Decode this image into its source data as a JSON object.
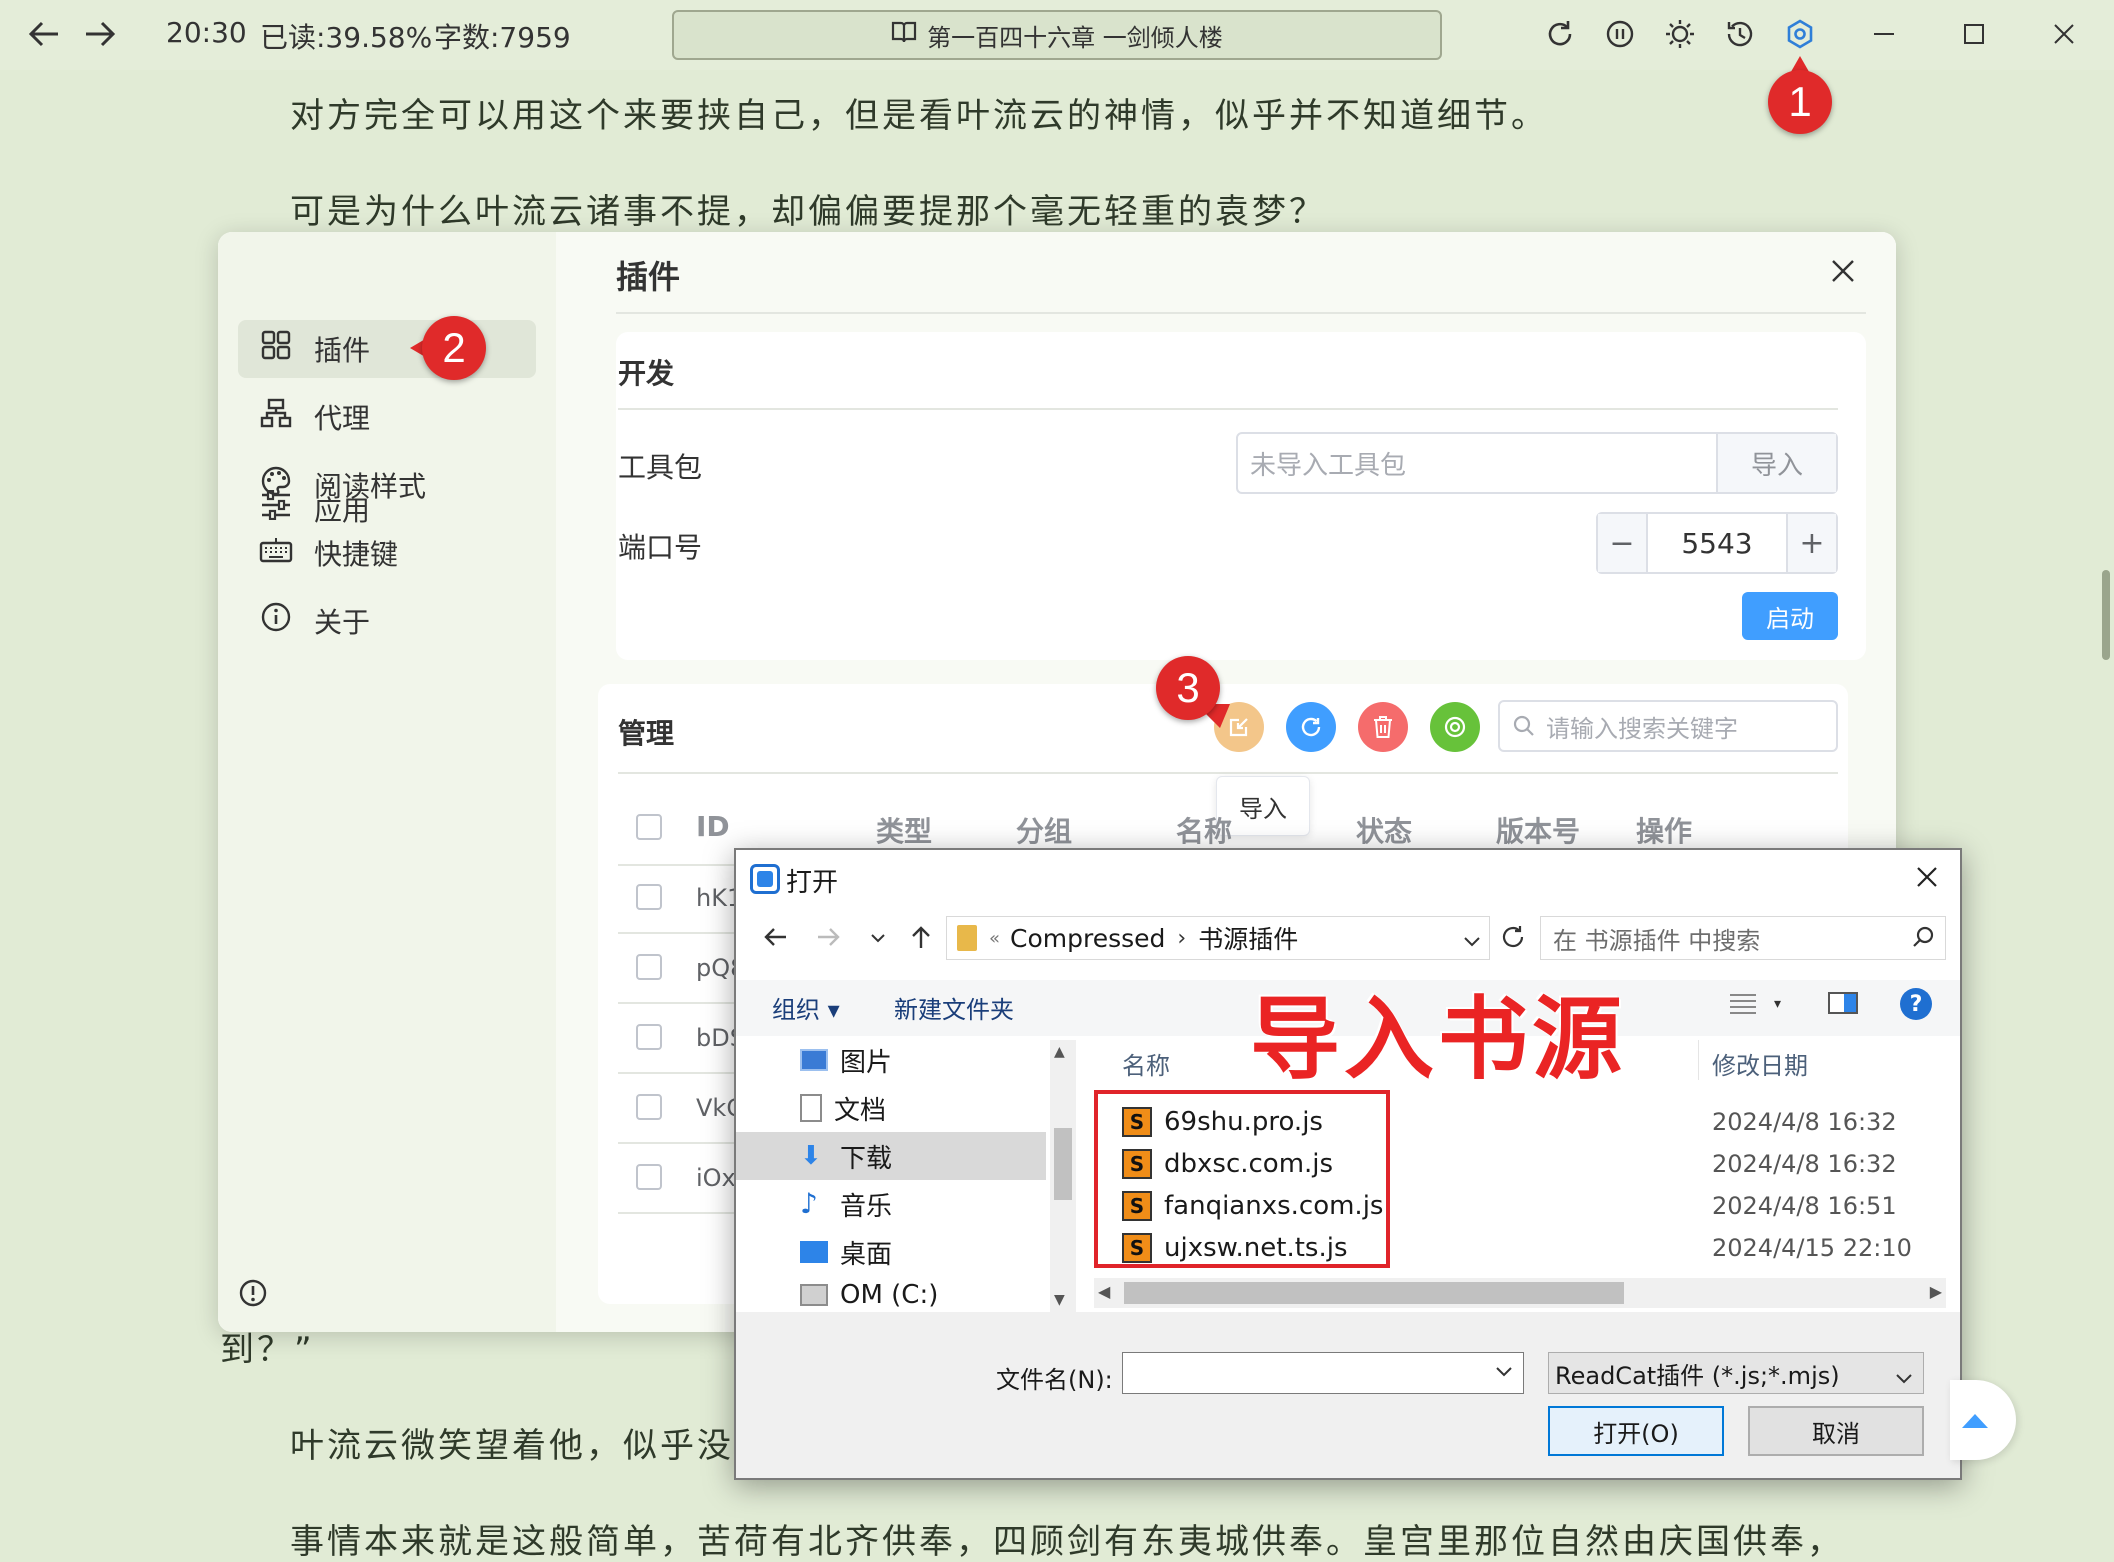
{
  "topbar": {
    "time": "20:30",
    "read_progress": "已读:39.58%",
    "word_count": "字数:7959",
    "chapter_title": "第一百四十六章 一剑倾人楼"
  },
  "reading": {
    "line1": "对方完全可以用这个来要挟自己，但是看叶流云的神情，似乎并不知道细节。",
    "line2": "可是为什么叶流云诸事不提，却偏偏要提那个毫无轻重的袁梦？",
    "line3": "到？”",
    "line4": "叶流云微笑望着他，似乎没",
    "line5": "事情本来就是这般简单，苦荷有北齐供奉，四顾剑有东夷城供奉。皇宫里那位自然由庆国供奉，"
  },
  "markers": [
    "1",
    "2",
    "3"
  ],
  "settings": {
    "sidebar": [
      {
        "label": "应用"
      },
      {
        "label": "插件"
      },
      {
        "label": "代理"
      },
      {
        "label": "阅读样式"
      },
      {
        "label": "快捷键"
      },
      {
        "label": "关于"
      }
    ],
    "title": "插件",
    "dev": {
      "heading": "开发",
      "toolkit_label": "工具包",
      "toolkit_placeholder": "未导入工具包",
      "import_label": "导入",
      "port_label": "端口号",
      "port_value": "5543",
      "start_label": "启动"
    },
    "manage": {
      "heading": "管理",
      "search_placeholder": "请输入搜索关键字",
      "tooltip": "导入",
      "columns": [
        "ID",
        "类型",
        "分组",
        "名称",
        "状态",
        "版本号",
        "操作"
      ],
      "rows": [
        "hK1",
        "pQ8",
        "bDS",
        "VkC",
        "iOx"
      ]
    }
  },
  "file_dialog": {
    "title": "打开",
    "path_parent": "Compressed",
    "path_current": "书源插件",
    "search_placeholder": "在 书源插件 中搜索",
    "organize": "组织",
    "new_folder": "新建文件夹",
    "overlay_title": "导入书源",
    "tree": [
      {
        "label": "图片"
      },
      {
        "label": "文档"
      },
      {
        "label": "下载"
      },
      {
        "label": "音乐"
      },
      {
        "label": "桌面"
      },
      {
        "label": "OM (C:)"
      }
    ],
    "col_name": "名称",
    "col_date": "修改日期",
    "files": [
      {
        "name": "69shu.pro.js",
        "date": "2024/4/8 16:32"
      },
      {
        "name": "dbxsc.com.js",
        "date": "2024/4/8 16:32"
      },
      {
        "name": "fanqianxs.com.js",
        "date": "2024/4/8 16:51"
      },
      {
        "name": "ujxsw.net.ts.js",
        "date": "2024/4/15 22:10"
      }
    ],
    "filename_label": "文件名(N):",
    "filter": "ReadCat插件 (*.js;*.mjs)",
    "open_btn": "打开(O)",
    "cancel_btn": "取消"
  },
  "colors": {
    "accent": "#409eff",
    "marker": "#e02a2a",
    "highlight_box": "#e0242a",
    "background": "#e1ebd5"
  }
}
